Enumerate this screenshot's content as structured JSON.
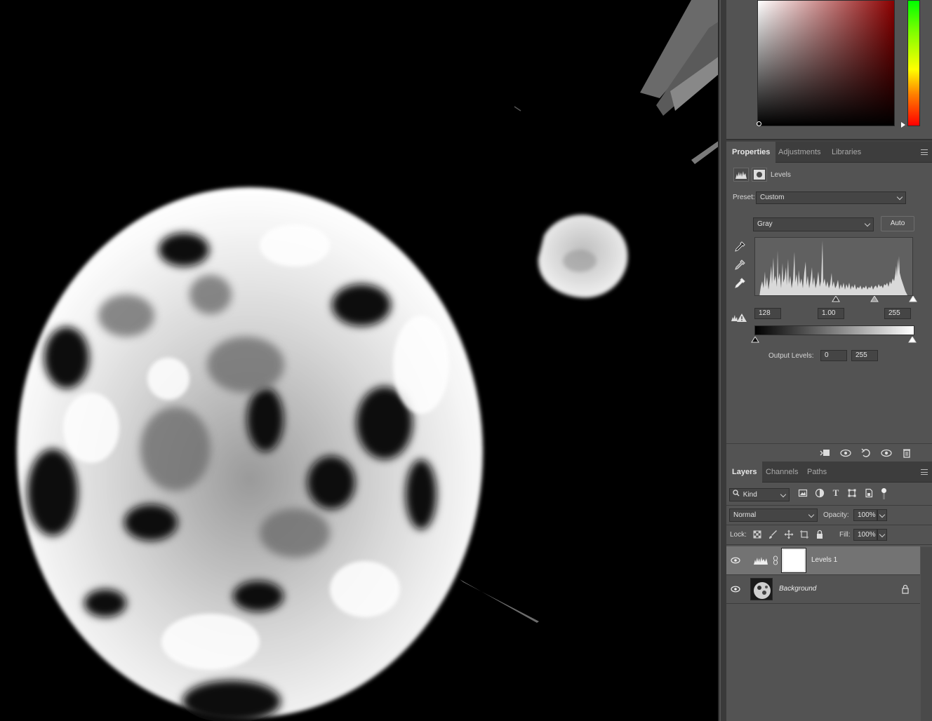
{
  "properties_panel": {
    "tabs": [
      "Properties",
      "Adjustments",
      "Libraries"
    ],
    "active_tab": "Properties",
    "title": "Levels",
    "preset_label": "Preset:",
    "preset_value": "Custom",
    "channel_value": "Gray",
    "auto_label": "Auto",
    "input_levels": {
      "black": "128",
      "gamma": "1.00",
      "white": "255"
    },
    "output_levels_label": "Output Levels:",
    "output_levels": {
      "black": "0",
      "white": "255"
    }
  },
  "layers_panel": {
    "tabs": [
      "Layers",
      "Channels",
      "Paths"
    ],
    "active_tab": "Layers",
    "filter_kind": "Kind",
    "blend_mode": "Normal",
    "opacity_label": "Opacity:",
    "opacity_value": "100%",
    "lock_label": "Lock:",
    "fill_label": "Fill:",
    "fill_value": "100%",
    "layers": [
      {
        "name": "Levels 1",
        "type": "adjustment",
        "visible": true,
        "selected": true
      },
      {
        "name": "Background",
        "type": "image",
        "visible": true,
        "locked": true
      }
    ]
  },
  "colors": {
    "canvas_bg": "#000000",
    "panel_bg": "#535353",
    "panel_dark": "#424242",
    "selected_layer": "#737373",
    "color_field_hue": "#8b0000"
  },
  "icons": {
    "eyedroppers": [
      "black-point-eyedropper-icon",
      "gray-point-eyedropper-icon",
      "white-point-eyedropper-icon"
    ],
    "footer": [
      "clip-to-layer-icon",
      "view-previous-state-icon",
      "reset-icon",
      "toggle-visibility-icon",
      "delete-icon"
    ],
    "layer_filters": [
      "pixel-filter-icon",
      "adjustment-filter-icon",
      "type-filter-icon",
      "shape-filter-icon",
      "smart-object-filter-icon",
      "filter-toggle-icon"
    ],
    "lock": [
      "lock-transparent-icon",
      "lock-image-icon",
      "lock-position-icon",
      "lock-artboard-icon",
      "lock-all-icon"
    ]
  }
}
